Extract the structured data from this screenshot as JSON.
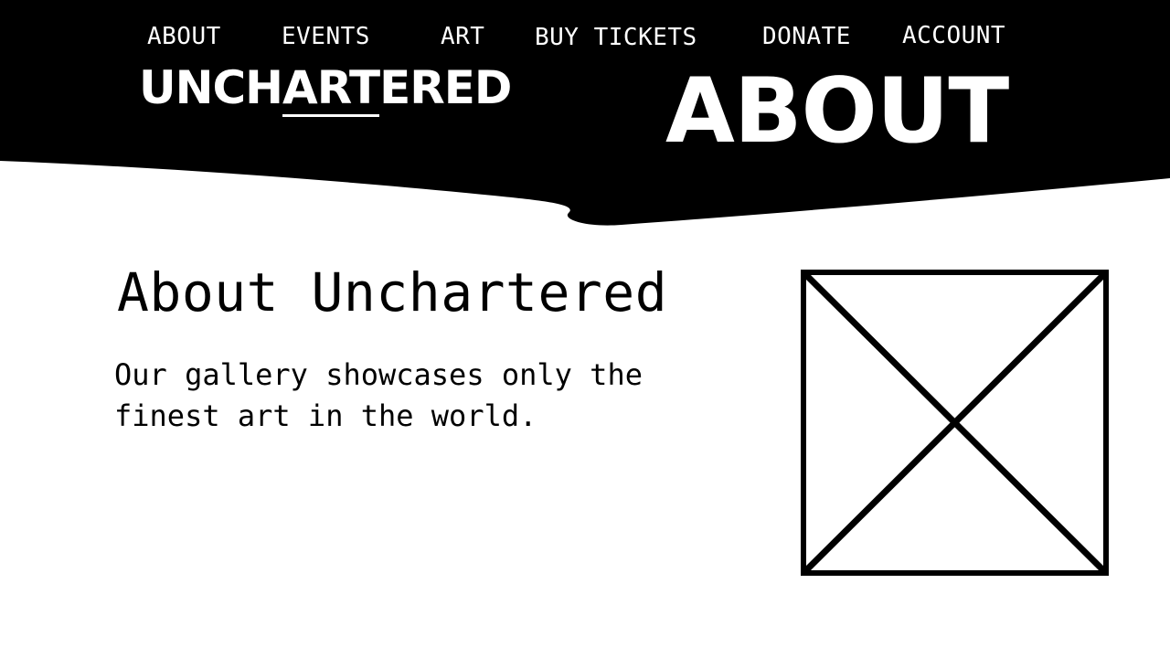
{
  "nav": {
    "items": [
      {
        "label": "ABOUT"
      },
      {
        "label": "EVENTS"
      },
      {
        "label": "ART"
      },
      {
        "label": "BUY TICKETS"
      },
      {
        "label": "DONATE"
      },
      {
        "label": "ACCOUNT"
      }
    ]
  },
  "logo": {
    "prefix": "UNCH",
    "accent": "ART",
    "suffix": "ERED"
  },
  "hero": {
    "title": "ABOUT"
  },
  "about": {
    "heading": "About Unchartered",
    "body": "Our gallery showcases only the finest art in the world."
  },
  "image": {
    "icon": "image-placeholder-icon"
  },
  "colors": {
    "header_background": "#000000",
    "header_text": "#ffffff",
    "body_text": "#000000",
    "page_background": "#ffffff"
  }
}
